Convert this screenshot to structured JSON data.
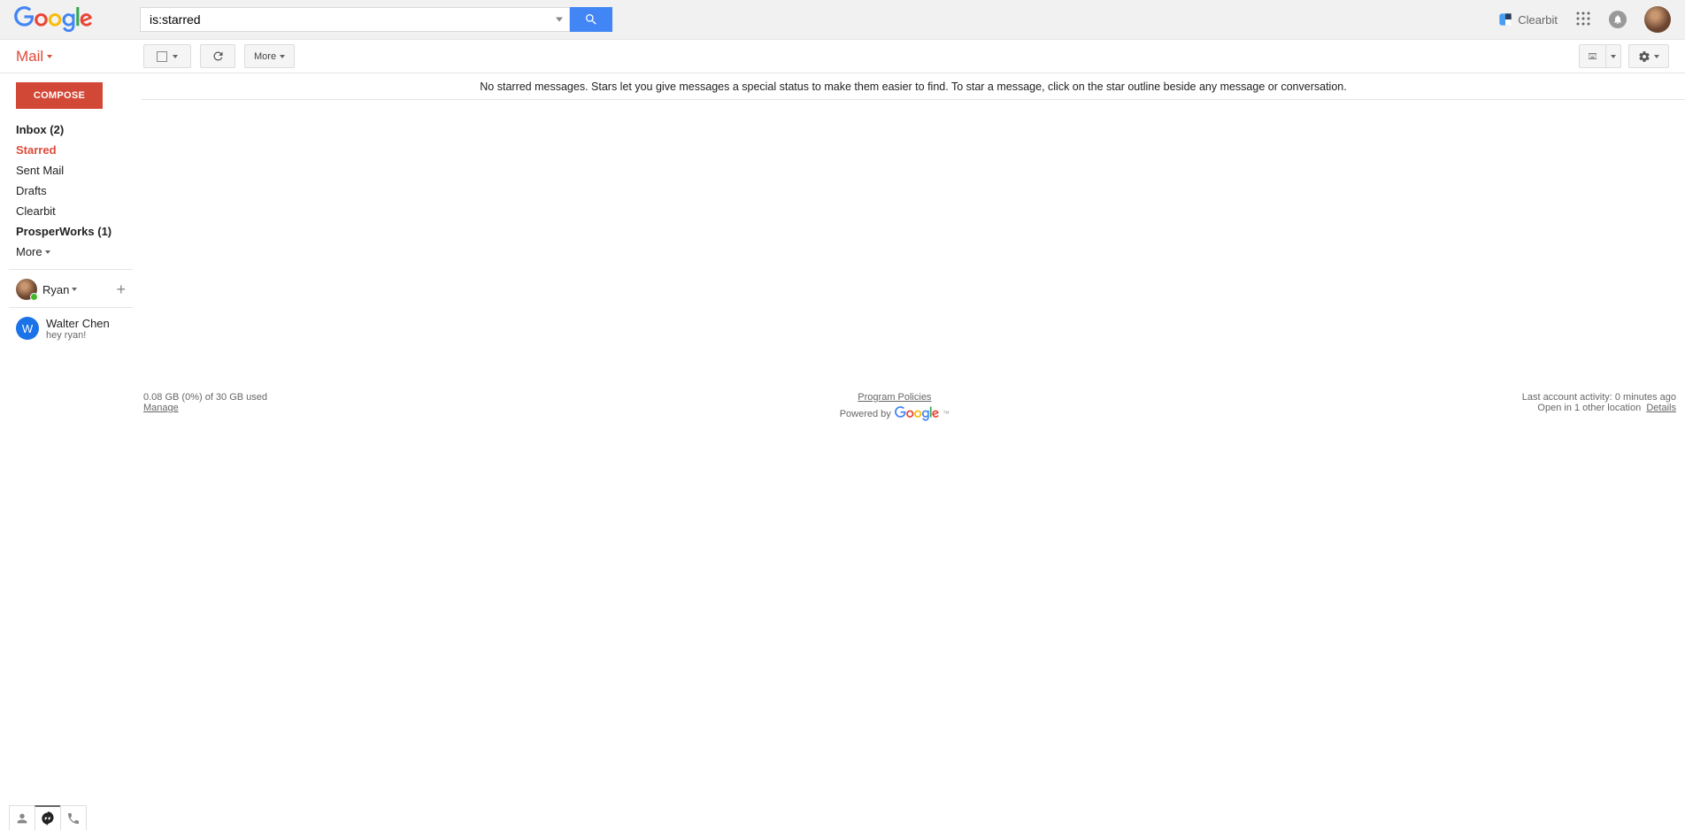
{
  "header": {
    "search_value": "is:starred",
    "clearbit_label": "Clearbit"
  },
  "subheader": {
    "mail_label": "Mail",
    "more_label": "More"
  },
  "sidebar": {
    "compose_label": "COMPOSE",
    "nav": {
      "inbox": "Inbox (2)",
      "starred": "Starred",
      "sent": "Sent Mail",
      "drafts": "Drafts",
      "clearbit": "Clearbit",
      "prosperworks": "ProsperWorks (1)",
      "more": "More"
    },
    "chat": {
      "self_name": "Ryan",
      "contact_name": "Walter Chen",
      "contact_initial": "W",
      "contact_msg": "hey ryan!"
    }
  },
  "main": {
    "empty_message": "No starred messages. Stars let you give messages a special status to make them easier to find. To star a message, click on the star outline beside any message or conversation."
  },
  "footer": {
    "storage": "0.08 GB (0%) of 30 GB used",
    "manage": "Manage",
    "policies": "Program Policies",
    "powered_by": "Powered by",
    "activity": "Last account activity: 0 minutes ago",
    "open_in": "Open in 1 other location",
    "details": "Details"
  }
}
